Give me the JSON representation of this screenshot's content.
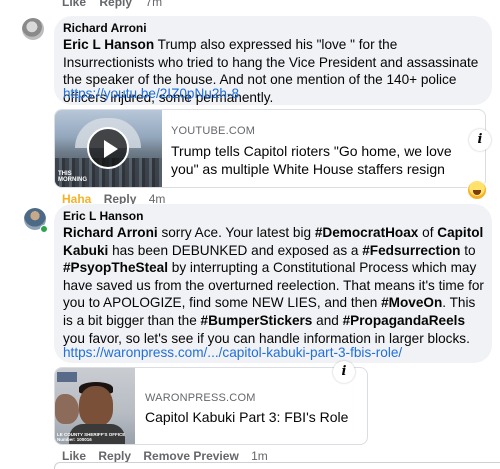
{
  "top_actions": {
    "like": "Like",
    "reply": "Reply",
    "time": "7m"
  },
  "comment1": {
    "author": "Richard Arroni",
    "mention": "Eric L Hanson",
    "text": " Trump also expressed his \"love \" for the Insurrectionists who tried to hang the Vice President and assassinate the speaker of the house. And not one mention of the 140+ police officers injured, some permanently.",
    "link": "https://youtu.be/2IZ0pNu2h-8",
    "preview": {
      "domain": "YOUTUBE.COM",
      "title": "Trump tells Capitol rioters \"Go home, we love you\" as multiple White House staffers resign",
      "thumb_brand_line1": "THIS",
      "thumb_brand_line2": "MORNING",
      "info_glyph": "i"
    },
    "actions": {
      "reaction": "Haha",
      "reply": "Reply",
      "time": "4m"
    }
  },
  "comment2": {
    "author": "Eric L Hanson",
    "mention": "Richard Arroni",
    "seg1": " sorry Ace. Your latest big ",
    "tag1": "#DemocratHoax",
    "seg2": " of ",
    "tag2": "Capitol Kabuki",
    "seg3": " has been DEBUNKED and exposed as a ",
    "tag3": "#Fedsurrection",
    "seg4": " to ",
    "tag4": "#PsyopTheSteal",
    "seg5": " by interrupting a Constitutional Process which may have saved us from the overturned reelection. That means it's time for you to APOLOGIZE, find some NEW LIES, and then ",
    "tag5": "#MoveOn",
    "seg6": ". This is a bit bigger than the ",
    "tag6": "#BumperStickers",
    "seg7": " and ",
    "tag7": "#PropagandaReels",
    "seg8": " you favor, so let's see if you can handle information in larger blocks.",
    "link": "https://waronpress.com/.../capitol-kabuki-part-3-fbis-role/",
    "preview": {
      "domain": "WARONPRESS.COM",
      "title": "Capitol Kabuki Part 3: FBI's Role",
      "thumb_caption_line1": "LE COUNTY SHERIFF'S OFFICE",
      "thumb_caption_line2": "Number: 100016",
      "info_glyph": "i"
    },
    "actions": {
      "like": "Like",
      "reply": "Reply",
      "remove": "Remove Preview",
      "time": "1m"
    }
  }
}
